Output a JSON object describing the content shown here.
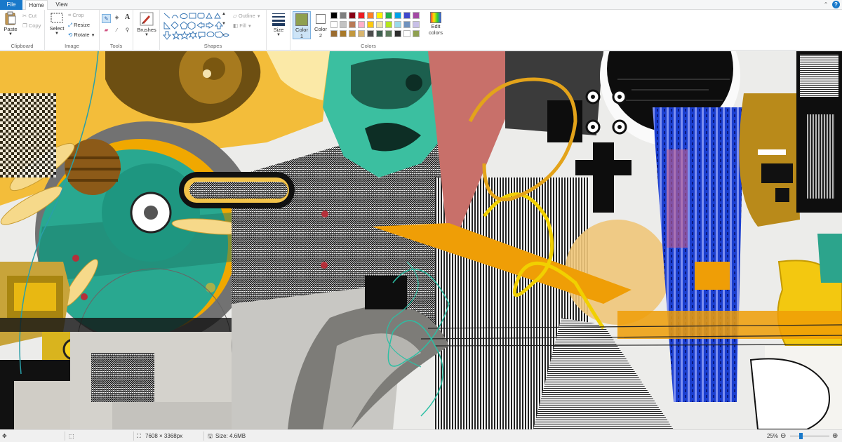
{
  "tabs": {
    "file": "File",
    "home": "Home",
    "view": "View"
  },
  "help": "?",
  "groups": {
    "clipboard": {
      "label": "Clipboard",
      "paste": "Paste",
      "cut": "Cut",
      "copy": "Copy"
    },
    "image": {
      "label": "Image",
      "select": "Select",
      "crop": "Crop",
      "resize": "Resize",
      "rotate": "Rotate"
    },
    "tools": {
      "label": "Tools"
    },
    "brushes": {
      "label": "Brushes"
    },
    "shapes": {
      "label": "Shapes",
      "outline": "Outline",
      "fill": "Fill"
    },
    "size": {
      "label": "Size"
    },
    "colors": {
      "label": "Colors",
      "color1_label": "Color",
      "color1_num": "1",
      "color2_label": "Color",
      "color2_num": "2",
      "edit_label": "Edit",
      "edit_label2": "colors",
      "color1_value": "#8fa050",
      "color2_value": "#ffffff",
      "palette": [
        "#000000",
        "#7f7f7f",
        "#880015",
        "#ed1c24",
        "#ff7f27",
        "#fff200",
        "#22b14c",
        "#00a2e8",
        "#3f48cc",
        "#a349a4",
        "#ffffff",
        "#c3c3c3",
        "#b97a57",
        "#ffaec9",
        "#ffc90e",
        "#efe4b0",
        "#b5e61d",
        "#99d9ea",
        "#7092be",
        "#c8bfe7",
        "#9a6b2f",
        "#a8792a",
        "#c2983e",
        "#d8b56e",
        "#4d4d4d",
        "#3f5f4f",
        "#5b7a5a",
        "#2d2d2d",
        "#ffffff",
        "#8fa050"
      ]
    }
  },
  "status": {
    "dimensions": "7608 × 3368px",
    "size": "Size: 4.6MB",
    "zoom": "25%",
    "zoom_level": 0.25
  }
}
